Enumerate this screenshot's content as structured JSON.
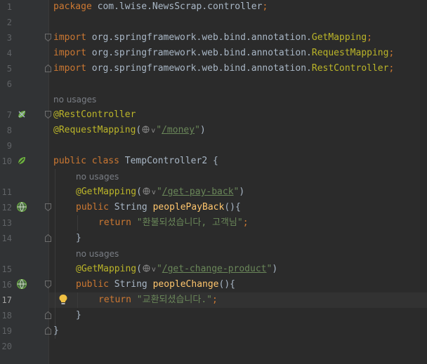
{
  "editor": {
    "current_line": 17,
    "line_numbers": [
      "1",
      "2",
      "3",
      "4",
      "5",
      "6",
      "7",
      "8",
      "9",
      "10",
      "11",
      "12",
      "13",
      "14",
      "15",
      "16",
      "17",
      "18",
      "19",
      "20"
    ],
    "hints": {
      "class_usages": "no usages",
      "method1_usages": "no usages",
      "method2_usages": "no usages"
    },
    "tokens": {
      "package_kw": "package",
      "package_name": " com.lwise.NewsScrap.controller",
      "semi": ";",
      "import_kw": "import",
      "import_pkg": " org.springframework.web.bind.annotation.",
      "getmapping": "GetMapping",
      "requestmapping": "RequestMapping",
      "restcontroller": "RestController",
      "ann_restcontroller": "@RestController",
      "ann_requestmapping": "@RequestMapping",
      "ann_getmapping": "@GetMapping",
      "paren_open": "(",
      "paren_close": ")",
      "quote": "\"",
      "chevron": "v",
      "url_money": "/money",
      "url_payback": "/get-pay-back",
      "url_change": "/get-change-product",
      "public_kw": "public",
      "class_kw": "class",
      "class_name": " TempController2 {",
      "string_type": " String ",
      "method_payback": "peoplePayBack",
      "method_change": "peopleChange",
      "method_sig_end": "(){",
      "return_kw": "return",
      "str_payback": "\"환불되셨습니다, 고객님\"",
      "str_change": "\"교환되셨습니다.\"",
      "close_brace": "}",
      "space": " "
    }
  },
  "colors": {
    "background": "#2b2b2b",
    "gutter": "#313335",
    "current_line": "#323232",
    "keyword": "#cc7832",
    "annotation": "#bbb529",
    "string": "#6a8759",
    "method": "#ffc66d",
    "plain": "#a9b7c6",
    "hint": "#7a7e85",
    "spring_icon": "#6db33f",
    "bulb": "#f0c043"
  },
  "gutter_icons": [
    "spring-bean-icon",
    "spring-bean-icon",
    "web-endpoint-icon",
    "web-endpoint-icon",
    "intention-bulb-icon"
  ]
}
